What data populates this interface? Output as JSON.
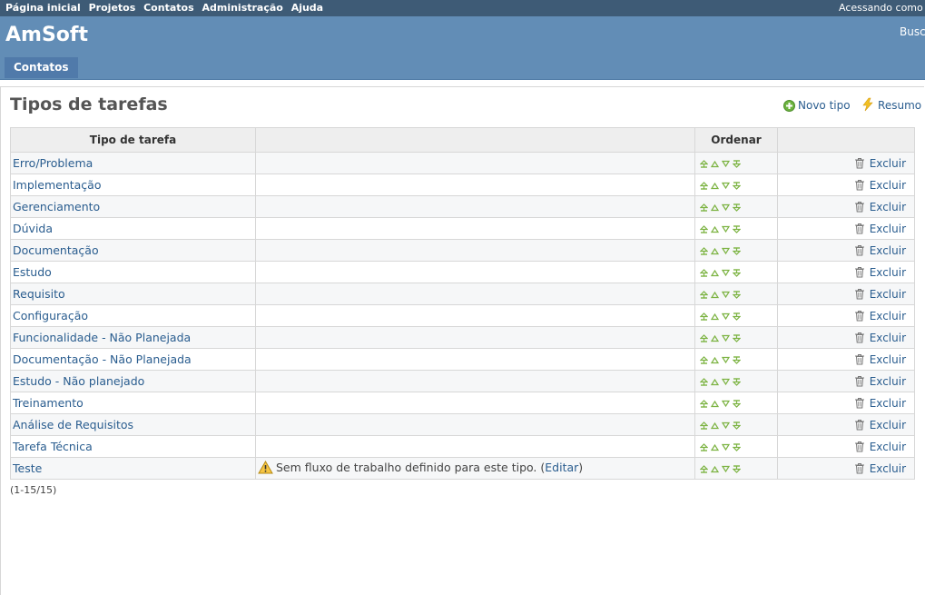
{
  "top_menu": {
    "links": [
      "Página inicial",
      "Projetos",
      "Contatos",
      "Administração",
      "Ajuda"
    ],
    "account": "Acessando como"
  },
  "header": {
    "brand": "AmSoft",
    "search": "Busc",
    "tab": "Contatos"
  },
  "page": {
    "title": "Tipos de tarefas",
    "new_label": "Novo tipo",
    "summary_label": "Resumo"
  },
  "table": {
    "headers": [
      "Tipo de tarefa",
      "",
      "Ordenar",
      ""
    ],
    "delete_label": "Excluir",
    "rows": [
      {
        "name": "Erro/Problema",
        "warning": ""
      },
      {
        "name": "Implementação",
        "warning": ""
      },
      {
        "name": "Gerenciamento",
        "warning": ""
      },
      {
        "name": "Dúvida",
        "warning": ""
      },
      {
        "name": "Documentação",
        "warning": ""
      },
      {
        "name": "Estudo",
        "warning": ""
      },
      {
        "name": "Requisito",
        "warning": ""
      },
      {
        "name": "Configuração",
        "warning": ""
      },
      {
        "name": "Funcionalidade - Não Planejada",
        "warning": ""
      },
      {
        "name": "Documentação - Não Planejada",
        "warning": ""
      },
      {
        "name": "Estudo - Não planejado",
        "warning": ""
      },
      {
        "name": "Treinamento",
        "warning": ""
      },
      {
        "name": "Análise de Requisitos",
        "warning": ""
      },
      {
        "name": "Tarefa Técnica",
        "warning": ""
      },
      {
        "name": "Teste",
        "warning": "Sem fluxo de trabalho definido para este tipo.",
        "warning_link": "Editar"
      }
    ]
  },
  "pagination": "(1-15/15)",
  "colors": {
    "top_bar": "#3e5b76",
    "header": "#628db6",
    "link": "#2a5d8f",
    "sort_arrow": "#7cb342"
  }
}
